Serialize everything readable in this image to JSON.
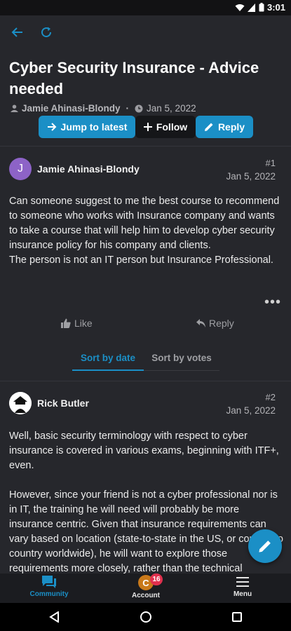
{
  "status_bar": {
    "time": "3:01"
  },
  "topic": {
    "title": "Cyber Security Insurance - Advice needed",
    "author": "Jamie Ahinasi-Blondy",
    "date": "Jan 5, 2022"
  },
  "actions": {
    "jump_label": "Jump to latest",
    "follow_label": "Follow",
    "reply_label": "Reply"
  },
  "posts": [
    {
      "avatar_letter": "J",
      "author": "Jamie Ahinasi-Blondy",
      "number": "#1",
      "date": "Jan 5, 2022",
      "body": "Can someone suggest to me the best course to recommend to someone who works with Insurance company and wants to take a course that will help him to develop cyber security insurance policy for his company and clients.\nThe person is not an IT person but Insurance Professional."
    },
    {
      "author": "Rick Butler",
      "number": "#2",
      "date": "Jan 5, 2022",
      "body": "Well, basic security terminology with respect to cyber insurance is covered in various exams, beginning with ITF+, even.\n\nHowever, since your friend is not a cyber professional nor is in IT, the training he will need will probably be more insurance centric. Given that insurance requirements can vary based on location (state-to-state in the US, or country to country worldwide), he will want to explore those requirements more closely, rather than the technical"
    }
  ],
  "post_actions": {
    "like_label": "Like",
    "reply_label": "Reply",
    "more_label": "•••"
  },
  "sort": {
    "by_date": "Sort by date",
    "by_votes": "Sort by votes",
    "active": "by_date"
  },
  "bottom_nav": {
    "community": "Community",
    "account": "Account",
    "account_badge": "16",
    "account_avatar_letter": "C",
    "menu": "Menu"
  },
  "colors": {
    "accent": "#1b8fc6",
    "background": "#26272c",
    "badge": "#e0304e",
    "avatar_j": "#8d63c7"
  },
  "icons": [
    "back-arrow-icon",
    "refresh-icon",
    "user-icon",
    "clock-icon",
    "arrow-right-icon",
    "plus-icon",
    "pencil-icon",
    "thumbs-up-icon",
    "reply-icon",
    "more-icon",
    "chat-icon",
    "menu-icon",
    "wifi-icon",
    "signal-icon",
    "battery-icon"
  ]
}
